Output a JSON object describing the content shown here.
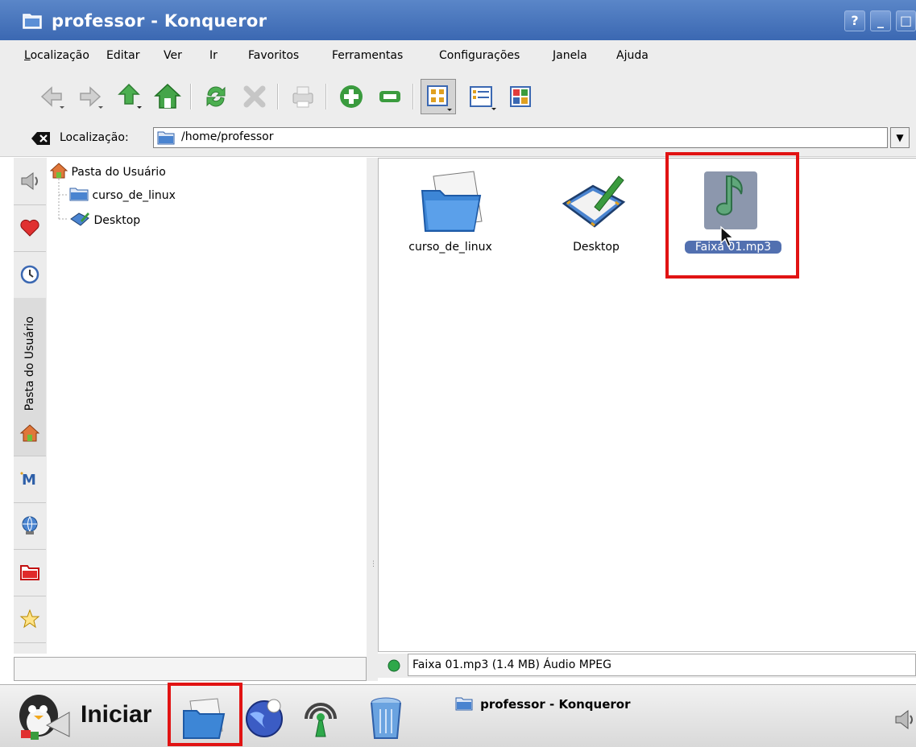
{
  "window": {
    "title": "professor - Konqueror",
    "buttons": {
      "help": "?",
      "minimize": "_",
      "maximize": "□"
    }
  },
  "menu": [
    {
      "label": "Localização",
      "accel": "L"
    },
    {
      "label": "Editar",
      "accel": "E"
    },
    {
      "label": "Ver",
      "accel": "V"
    },
    {
      "label": "Ir",
      "accel": "I"
    },
    {
      "label": "Favoritos",
      "accel": "F"
    },
    {
      "label": "Ferramentas",
      "accel": "r"
    },
    {
      "label": "Configurações",
      "accel": "C"
    },
    {
      "label": "Janela",
      "accel": "n"
    },
    {
      "label": "Ajuda",
      "accel": ""
    }
  ],
  "toolbar": {
    "icons": [
      "back-icon",
      "forward-icon",
      "up-icon",
      "home-icon",
      "reload-icon",
      "stop-icon",
      "print-icon",
      "zoom-in-icon",
      "zoom-out-icon",
      "icon-view-icon",
      "detail-view-icon",
      "multicolumn-view-icon"
    ]
  },
  "location": {
    "label": "Localização:",
    "value": "/home/professor"
  },
  "sidebar": {
    "vertical_tab_label": "Pasta do Usuário",
    "tabs": [
      "speaker-icon",
      "heart-icon",
      "clock-icon",
      "home-icon",
      "bookmarks-m-icon",
      "network-icon",
      "folder-icon",
      "star-icon"
    ]
  },
  "tree": {
    "root": "Pasta do Usuário",
    "children": [
      "curso_de_linux",
      "Desktop"
    ]
  },
  "files": [
    {
      "name": "curso_de_linux",
      "icon": "folder-icon"
    },
    {
      "name": "Desktop",
      "icon": "desktop-icon"
    },
    {
      "name": "Faixa 01.mp3",
      "icon": "music-note-icon",
      "selected": true
    }
  ],
  "status": {
    "text": "Faixa 01.mp3 (1.4 MB) Áudio MPEG"
  },
  "taskbar": {
    "start_label": "Iniciar",
    "task_title": "professor - Konqueror"
  },
  "colors": {
    "titlebar": "#3b68b2",
    "highlight_box": "#e11313",
    "selection": "#5270b0"
  }
}
